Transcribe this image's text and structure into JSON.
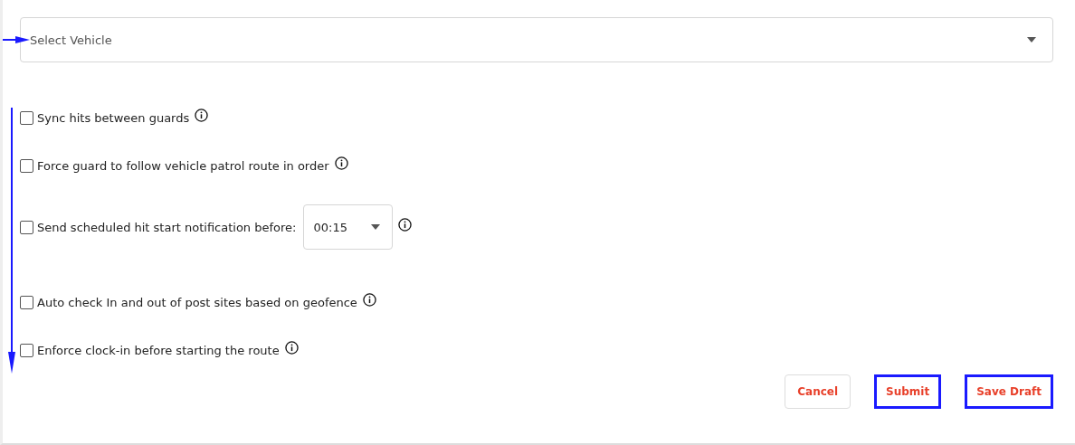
{
  "vehicle_select": {
    "placeholder": "Select Vehicle"
  },
  "options": [
    {
      "kind": "plain",
      "label": "Sync hits between guards",
      "checked": false
    },
    {
      "kind": "plain",
      "label": "Force guard to follow vehicle patrol route in order",
      "checked": false
    },
    {
      "kind": "select",
      "label": "Send scheduled hit start notification before:",
      "checked": false,
      "value": "00:15"
    },
    {
      "kind": "plain",
      "label": "Auto check In and out of post sites based on geofence",
      "checked": false
    },
    {
      "kind": "plain",
      "label": "Enforce clock-in before starting the route",
      "checked": false
    }
  ],
  "buttons": [
    {
      "label": "Cancel",
      "highlighted": false
    },
    {
      "label": "Submit",
      "highlighted": true
    },
    {
      "label": "Save Draft",
      "highlighted": true
    }
  ]
}
